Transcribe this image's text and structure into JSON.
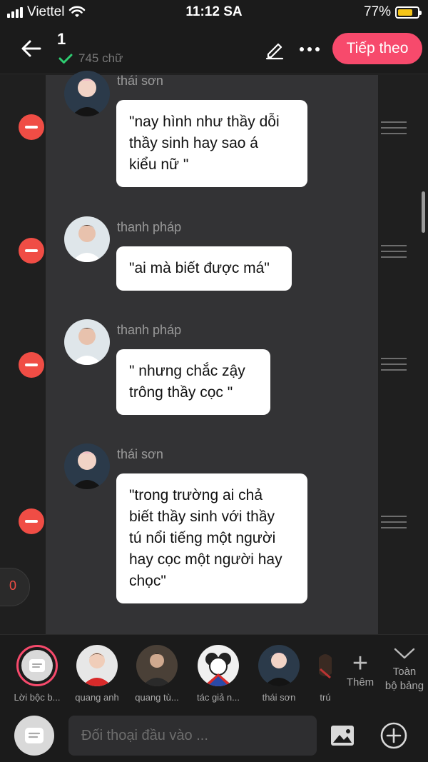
{
  "status_bar": {
    "carrier": "Viettel",
    "time": "11:12 SA",
    "battery": "77%",
    "battery_level": 0.77,
    "battery_color": "#f5c518"
  },
  "header": {
    "number": "1",
    "word_count": "745 chữ",
    "next_label": "Tiếp theo",
    "accent_color": "#f74a6c"
  },
  "messages": [
    {
      "username": "thái sơn",
      "lines": [
        "\"nay hình như thầy dỗi",
        "thầy sinh hay sao á",
        "kiểu nữ \""
      ]
    },
    {
      "username": "thanh pháp",
      "lines": [
        "\"ai mà biết được má\""
      ]
    },
    {
      "username": "thanh pháp",
      "lines": [
        "\" nhưng chắc zậy",
        "trông thầy cọc \""
      ]
    },
    {
      "username": "thái sơn",
      "lines": [
        "\"trong trường ai chả",
        "biết thầy sinh với thầy",
        "tú nổi tiếng một người",
        "hay cọc một người hay",
        "chọc\""
      ]
    }
  ],
  "side_badge": "0",
  "characters": [
    {
      "label": "Lời bộc b..."
    },
    {
      "label": "quang anh"
    },
    {
      "label": "quang tù..."
    },
    {
      "label": "tác giả n..."
    },
    {
      "label": "thái sơn"
    },
    {
      "label": "trú"
    }
  ],
  "more_label": "Thêm",
  "collapse_label_1": "Toàn",
  "collapse_label_2": "bộ bảng",
  "input": {
    "placeholder": "Đối thoại đầu vào ..."
  }
}
